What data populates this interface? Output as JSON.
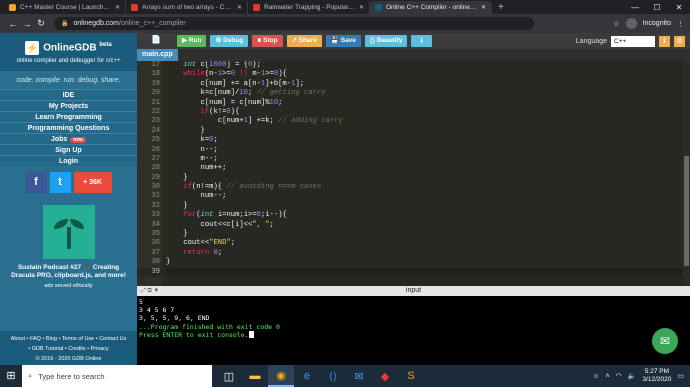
{
  "browser": {
    "tabs": [
      {
        "title": "C++ Master Course | Launchpad",
        "color": "#f5a623"
      },
      {
        "title": "Arrays sum of two arrays - Coding",
        "color": "#e53935"
      },
      {
        "title": "Rainwater Trapping - Popular Int",
        "color": "#e53935"
      },
      {
        "title": "Online C++ Compiler - online edit",
        "color": "#1a5a7a"
      }
    ],
    "new_tab": "+",
    "url_host": "onlinegdb.com",
    "url_path": "/online_c++_compiler",
    "profile_label": "Incognito"
  },
  "sidebar": {
    "brand": "OnlineGDB",
    "beta": "beta",
    "brand_sub": "online compiler and debugger for c/c++",
    "tagline": "code. compile. run. debug. share.",
    "items": [
      {
        "label": "IDE"
      },
      {
        "label": "My Projects"
      },
      {
        "label": "Learn Programming"
      },
      {
        "label": "Programming Questions"
      },
      {
        "label": "Jobs"
      },
      {
        "label": "Sign Up"
      },
      {
        "label": "Login"
      }
    ],
    "jobs_badge": "new",
    "social": {
      "facebook": "f",
      "twitter": "t",
      "share": "+ 36K"
    },
    "podcast": "Sustain Podcast #27 🎧 Creating Dracula PRO, clipboard.js, and more!",
    "ads": "ads served ethically",
    "footer": [
      "About • FAQ • Blog • Terms of Use • Contact Us",
      "• GDB Tutorial • Credits • Privacy",
      "© 2016 - 2020 GDB Online"
    ]
  },
  "toolbar": {
    "run": "▶ Run",
    "debug": "⚙ Debug",
    "stop": "■ Stop",
    "share": "↗ Share",
    "save": "💾 Save",
    "beautify": "{} Beautify",
    "download": "⭳",
    "language_label": "Language",
    "language_value": "C++"
  },
  "file_tab": "main.cpp",
  "editor": {
    "line_numbers": [
      "17",
      "18",
      "19",
      "20",
      "21",
      "22",
      "23",
      "24",
      "25",
      "26",
      "27",
      "28",
      "29",
      "30",
      "31",
      "32",
      "33",
      "34",
      "35",
      "36",
      "37",
      "38",
      "39"
    ]
  },
  "input_bar": {
    "label": "input"
  },
  "console": {
    "lines": [
      "5",
      "3 4 5 6 7",
      "3, 5, 5, 9, 6, END",
      "",
      "",
      "...Program finished with exit code 0",
      "Press ENTER to exit console."
    ]
  },
  "taskbar": {
    "search_placeholder": "Type here to search",
    "time": "5:27 PM",
    "date": "3/12/2020"
  }
}
